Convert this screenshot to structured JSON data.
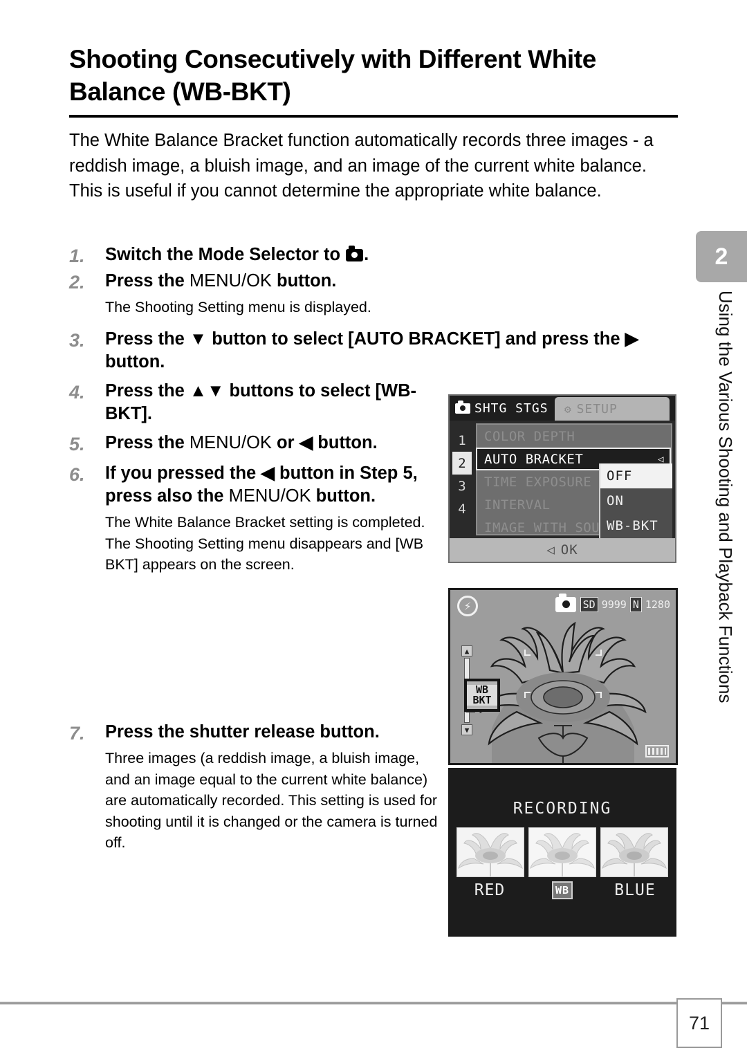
{
  "heading": {
    "line1": "Shooting Consecutively with Different White",
    "line2": "Balance (WB-BKT)"
  },
  "intro": {
    "p1": "The White Balance Bracket function automatically records three images - a reddish image, a bluish image, and an image of the current white balance.",
    "p2": "This is useful if you cannot determine the appropriate white balance."
  },
  "steps": [
    {
      "num": "1.",
      "title_pre": "Switch the Mode Selector to ",
      "title_post": ".",
      "icon": "camera-mode-icon",
      "note": ""
    },
    {
      "num": "2.",
      "title_pre": "Press the ",
      "title_mid": "MENU/OK",
      "title_post": " button.",
      "note": "The Shooting Setting menu is displayed."
    },
    {
      "num": "3.",
      "title": "Press the ▼ button to select [AUTO BRACKET] and press the ▶ button.",
      "note": ""
    },
    {
      "num": "4.",
      "title": "Press the ▲▼ buttons to select [WB-BKT].",
      "note": ""
    },
    {
      "num": "5.",
      "title_pre": "Press the ",
      "title_mid": "MENU/OK",
      "title_post": " or ◀ button.",
      "note": ""
    },
    {
      "num": "6.",
      "title_pre": "If you pressed the ◀ button in Step 5, press also the ",
      "title_mid": "MENU/OK",
      "title_post": " button.",
      "note": "The White Balance Bracket setting is completed.\nThe Shooting Setting menu disappears and [WB BKT] appears on the screen."
    },
    {
      "num": "7.",
      "title": "Press the shutter release button.",
      "note": "Three images (a reddish image, a bluish image, and an image equal to the current white balance) are automatically recorded. This setting is used for shooting until it is changed or the camera is turned off."
    }
  ],
  "side_tab": {
    "chapter_number": "2",
    "chapter_title": "Using the Various Shooting and Playback Functions"
  },
  "footer": {
    "page_number": "71"
  },
  "menu_screen": {
    "tabs": [
      {
        "label": "SHTG STGS",
        "icon": "camera-icon",
        "active": true
      },
      {
        "label": "SETUP",
        "icon": "wrench-icon",
        "active": false
      }
    ],
    "rail_numbers": [
      "1",
      "2",
      "3",
      "4"
    ],
    "rail_active": "2",
    "items": [
      {
        "label": "COLOR DEPTH",
        "selected": false
      },
      {
        "label": "AUTO BRACKET",
        "selected": true
      },
      {
        "label": "TIME EXPOSURE",
        "selected": false
      },
      {
        "label": "INTERVAL",
        "selected": false
      },
      {
        "label": "IMAGE WITH SOUND",
        "selected": false
      }
    ],
    "dropdown": {
      "options": [
        {
          "label": "OFF",
          "active": true
        },
        {
          "label": "ON",
          "active": false
        },
        {
          "label": "WB-BKT",
          "active": false
        }
      ]
    },
    "ok_bar": {
      "arrow": "◁",
      "label": "OK"
    }
  },
  "live_view": {
    "flash_icon": "flash-off-icon",
    "camera_icon": "still-image-mode-icon",
    "hud": {
      "card": "SD",
      "remaining": "9999",
      "quality": "N",
      "size": "1280"
    },
    "wb_badge_line1": "WB",
    "wb_badge_line2": "BKT",
    "zoom_top": "▲",
    "zoom_bottom": "▼"
  },
  "recording_screen": {
    "title": "RECORDING",
    "thumbs": [
      {
        "label": "RED",
        "type": "text"
      },
      {
        "label": "WB",
        "type": "badge"
      },
      {
        "label": "BLUE",
        "type": "text"
      }
    ]
  },
  "colors": {
    "tab_grey": "#a8a8a8",
    "step_number_grey": "#8d8d8d",
    "rule_black": "#000000",
    "footer_rule": "#9a9a9a",
    "lcd_dark": "#1e1e1e",
    "lcd_mid": "#6e6e6e"
  }
}
